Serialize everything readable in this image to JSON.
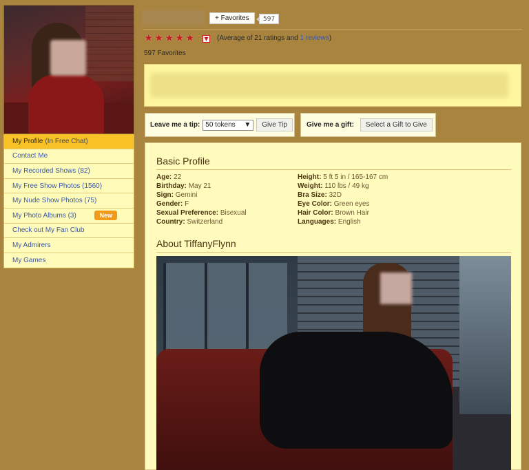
{
  "sidebar": {
    "avatar_alt": "profile photo",
    "menu": [
      {
        "label": "My Profile",
        "extra": "(In Free Chat)",
        "active": true
      },
      {
        "label": "Contact Me"
      },
      {
        "label": "My Recorded Shows (82)"
      },
      {
        "label": "My Free Show Photos (1560)"
      },
      {
        "label": "My Nude Show Photos (75)"
      },
      {
        "label": "My Photo Albums (3)",
        "badge": "New"
      },
      {
        "label": "Check out My Fan Club"
      },
      {
        "label": "My Admirers"
      },
      {
        "label": "My Games"
      }
    ]
  },
  "header": {
    "favorites_button": "+ Favorites",
    "favorites_count": "597",
    "rating_stars": 5,
    "rating_prefix": "(Average of 21 ratings and ",
    "rating_link": "1 reviews",
    "rating_suffix": ")",
    "favorites_total": "597 Favorites"
  },
  "tip": {
    "label": "Leave me a tip:",
    "selected": "50 tokens",
    "button": "Give Tip"
  },
  "gift": {
    "label": "Give me a gift:",
    "button": "Select a Gift to Give"
  },
  "basic_profile": {
    "title": "Basic Profile",
    "left": [
      {
        "k": "Age:",
        "v": "22"
      },
      {
        "k": "Birthday:",
        "v": "May 21"
      },
      {
        "k": "Sign:",
        "v": "Gemini"
      },
      {
        "k": "Gender:",
        "v": "F"
      },
      {
        "k": "Sexual Preference:",
        "v": "Bisexual"
      },
      {
        "k": "Country:",
        "v": "Switzerland"
      }
    ],
    "right": [
      {
        "k": "Height:",
        "v": "5 ft 5 in / 165-167 cm"
      },
      {
        "k": "Weight:",
        "v": "110 lbs / 49 kg"
      },
      {
        "k": "Bra Size:",
        "v": "32D"
      },
      {
        "k": "Eye Color:",
        "v": "Green eyes"
      },
      {
        "k": "Hair Color:",
        "v": "Brown Hair"
      },
      {
        "k": "Languages:",
        "v": "English"
      }
    ]
  },
  "about": {
    "title": "About TiffanyFlynn"
  },
  "colors": {
    "page_bg": "#a8843f",
    "menu_bg": "#fffbb8",
    "menu_active": "#f8c126",
    "link": "#3b57a8",
    "badge": "#f19a1c",
    "star": "#c42020"
  }
}
